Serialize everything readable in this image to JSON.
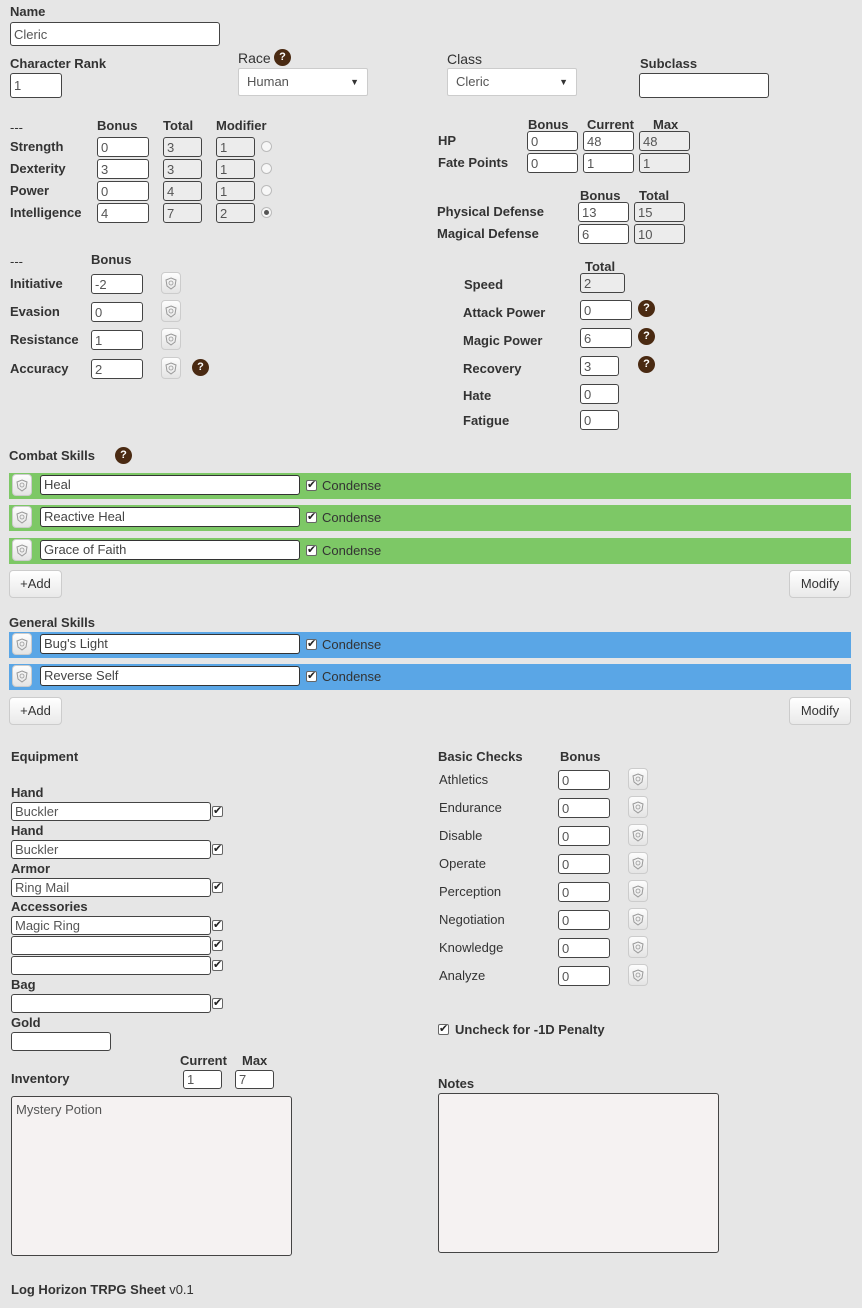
{
  "name": {
    "label": "Name",
    "value": "Cleric"
  },
  "rank": {
    "label": "Character Rank",
    "value": "1"
  },
  "race": {
    "label": "Race",
    "value": "Human",
    "help": "?"
  },
  "class": {
    "label": "Class",
    "value": "Cleric"
  },
  "subclass": {
    "label": "Subclass",
    "value": ""
  },
  "attributes": {
    "dash": "---",
    "headers": {
      "bonus": "Bonus",
      "total": "Total",
      "modifier": "Modifier"
    },
    "rows": [
      {
        "label": "Strength",
        "bonus": "0",
        "total": "3",
        "modifier": "1",
        "selected": false
      },
      {
        "label": "Dexterity",
        "bonus": "3",
        "total": "3",
        "modifier": "1",
        "selected": false
      },
      {
        "label": "Power",
        "bonus": "0",
        "total": "4",
        "modifier": "1",
        "selected": false
      },
      {
        "label": "Intelligence",
        "bonus": "4",
        "total": "7",
        "modifier": "2",
        "selected": true
      }
    ]
  },
  "hp_fate": {
    "headers": {
      "bonus": "Bonus",
      "current": "Current",
      "max": "Max"
    },
    "hp": {
      "label": "HP",
      "bonus": "0",
      "current": "48",
      "max": "48"
    },
    "fate": {
      "label": "Fate Points",
      "bonus": "0",
      "current": "1",
      "max": "1"
    }
  },
  "defense": {
    "headers": {
      "bonus": "Bonus",
      "total": "Total"
    },
    "physical": {
      "label": "Physical Defense",
      "bonus": "13",
      "total": "15"
    },
    "magical": {
      "label": "Magical Defense",
      "bonus": "6",
      "total": "10"
    }
  },
  "combat_stats": {
    "dash": "---",
    "header": "Bonus",
    "rows": [
      {
        "label": "Initiative",
        "value": "-2"
      },
      {
        "label": "Evasion",
        "value": "0"
      },
      {
        "label": "Resistance",
        "value": "1"
      },
      {
        "label": "Accuracy",
        "value": "2"
      }
    ]
  },
  "secondary": {
    "header": "Total",
    "speed": {
      "label": "Speed",
      "value": "2"
    },
    "attack": {
      "label": "Attack Power",
      "value": "0"
    },
    "magic": {
      "label": "Magic Power",
      "value": "6"
    },
    "recovery": {
      "label": "Recovery",
      "value": "3"
    },
    "hate": {
      "label": "Hate",
      "value": "0"
    },
    "fatigue": {
      "label": "Fatigue",
      "value": "0"
    }
  },
  "combat_skills": {
    "title": "Combat Skills",
    "color": "#7dc866",
    "items": [
      {
        "name": "Heal",
        "condense": "Condense"
      },
      {
        "name": "Reactive Heal",
        "condense": "Condense"
      },
      {
        "name": "Grace of Faith",
        "condense": "Condense"
      }
    ],
    "add_label": "+Add",
    "modify_label": "Modify"
  },
  "general_skills": {
    "title": "General Skills",
    "color": "#5aa6e6",
    "items": [
      {
        "name": "Bug's Light",
        "condense": "Condense"
      },
      {
        "name": "Reverse Self",
        "condense": "Condense"
      }
    ],
    "add_label": "+Add",
    "modify_label": "Modify"
  },
  "equipment": {
    "title": "Equipment",
    "hand1": {
      "label": "Hand",
      "value": "Buckler"
    },
    "hand2": {
      "label": "Hand",
      "value": "Buckler"
    },
    "armor": {
      "label": "Armor",
      "value": "Ring Mail"
    },
    "accessories": {
      "label": "Accessories",
      "values": [
        "Magic Ring",
        "",
        ""
      ]
    },
    "bag": {
      "label": "Bag",
      "value": ""
    },
    "gold": {
      "label": "Gold",
      "value": ""
    }
  },
  "inventory": {
    "label": "Inventory",
    "current_label": "Current",
    "max_label": "Max",
    "current": "1",
    "max": "7",
    "contents": "Mystery Potion"
  },
  "basic_checks": {
    "title": "Basic Checks",
    "bonus_header": "Bonus",
    "rows": [
      {
        "label": "Athletics",
        "value": "0"
      },
      {
        "label": "Endurance",
        "value": "0"
      },
      {
        "label": "Disable",
        "value": "0"
      },
      {
        "label": "Operate",
        "value": "0"
      },
      {
        "label": "Perception",
        "value": "0"
      },
      {
        "label": "Negotiation",
        "value": "0"
      },
      {
        "label": "Knowledge",
        "value": "0"
      },
      {
        "label": "Analyze",
        "value": "0"
      }
    ],
    "penalty_label": "Uncheck for -1D Penalty"
  },
  "notes": {
    "label": "Notes",
    "value": ""
  },
  "footer": {
    "title": "Log Horizon TRPG Sheet",
    "version": "v0.1"
  }
}
